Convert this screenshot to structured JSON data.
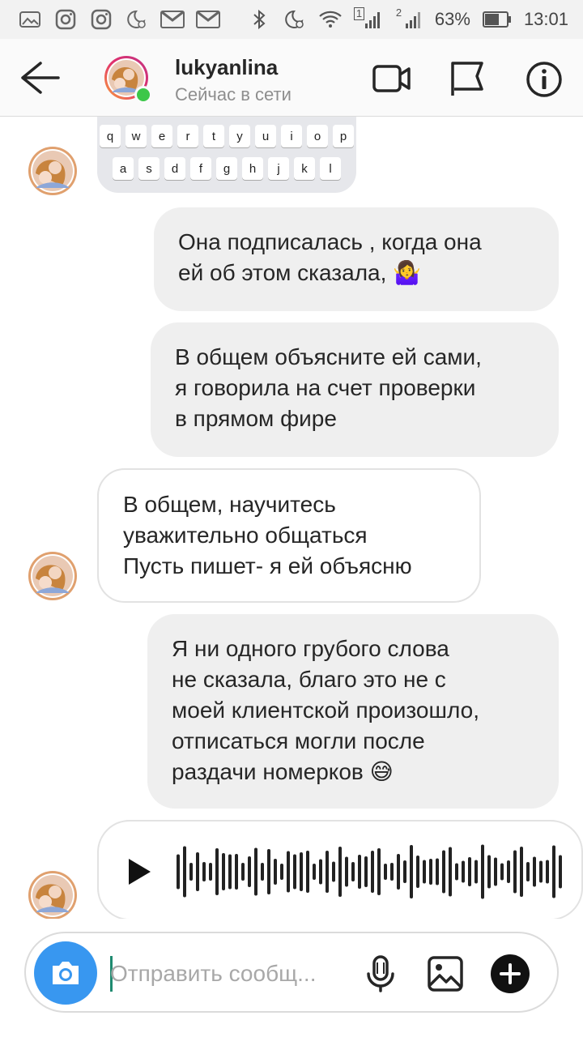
{
  "status_bar": {
    "battery": "63%",
    "time": "13:01",
    "sim1": "1",
    "sim2": "2"
  },
  "header": {
    "username": "lukyanlina",
    "status": "Сейчас в сети"
  },
  "keyboard_preview": {
    "row1": [
      "q",
      "w",
      "e",
      "r",
      "t",
      "y",
      "u",
      "i",
      "o",
      "p"
    ],
    "row2": [
      "a",
      "s",
      "d",
      "f",
      "g",
      "h",
      "j",
      "k",
      "l"
    ]
  },
  "messages": [
    {
      "direction": "outgoing",
      "text": "Она подписалась , когда она\nей об этом сказала, 🤷‍♀️"
    },
    {
      "direction": "outgoing",
      "text": "В общем объясните ей сами,\nя говорила на счет проверки\nв прямом фире"
    },
    {
      "direction": "incoming",
      "text": "В общем, научитесь\nуважительно общаться\nПусть пишет- я ей объясню"
    },
    {
      "direction": "outgoing",
      "text": "Я ни одного грубого слова\nне сказала, благо это не с\nмоей клиентской произошло,\nотписаться могли после\nраздачи номерков 😅"
    }
  ],
  "composer": {
    "placeholder": "Отправить сообщ..."
  },
  "colors": {
    "accent": "#3897f0",
    "online": "#3cc749",
    "outgoing_bubble": "#efefef"
  }
}
